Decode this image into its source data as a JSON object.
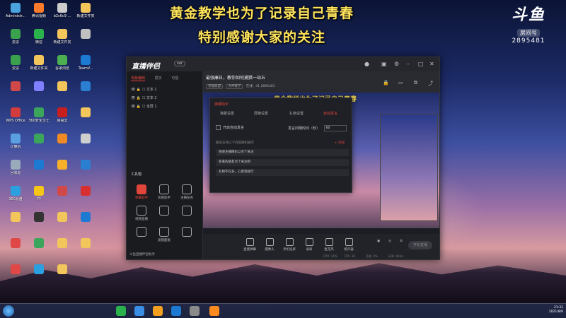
{
  "banner": {
    "line1": "黄金教学也为了记录自己青春",
    "line2": "特别感谢大家的关注"
  },
  "douyu": {
    "logo": "斗鱼",
    "room_label": "房间号",
    "room_number": "2895481"
  },
  "desktop_icons": [
    {
      "label": "Administr...",
      "color": "#4aa3df"
    },
    {
      "label": "腾讯视频",
      "color": "#ff7a2a"
    },
    {
      "label": "b2c6c9 ...",
      "color": "#cccccc"
    },
    {
      "label": "新建文件夹",
      "color": "#f3c65c"
    },
    {
      "label": "爱思",
      "color": "#3aa14d"
    },
    {
      "label": "微信",
      "color": "#2bb24c"
    },
    {
      "label": "新建文件夹",
      "color": "#f3c65c"
    },
    {
      "label": "",
      "color": "#c0c0c0"
    },
    {
      "label": "爱思",
      "color": "#3aa14d"
    },
    {
      "label": "新建文件夹",
      "color": "#f3c65c"
    },
    {
      "label": "谷歌浏览",
      "color": "#4caf50"
    },
    {
      "label": "TeamV...",
      "color": "#1c7ad3"
    },
    {
      "label": "",
      "color": "#d04848"
    },
    {
      "label": "",
      "color": "#7f7fff"
    },
    {
      "label": "",
      "color": "#f3c65c"
    },
    {
      "label": "",
      "color": "#2a7fd1"
    },
    {
      "label": "WPS Office",
      "color": "#d23c3c"
    },
    {
      "label": "360安全卫士",
      "color": "#3ba55c"
    },
    {
      "label": "网易云",
      "color": "#c81e1e"
    },
    {
      "label": "",
      "color": "#f3c65c"
    },
    {
      "label": "计算机",
      "color": "#5aa0e0"
    },
    {
      "label": "",
      "color": "#3ba55c"
    },
    {
      "label": "",
      "color": "#f08a24"
    },
    {
      "label": "",
      "color": "#cfcfcf"
    },
    {
      "label": "回收站",
      "color": "#9ab"
    },
    {
      "label": "",
      "color": "#1c7ad3"
    },
    {
      "label": "",
      "color": "#f6b12b"
    },
    {
      "label": "",
      "color": "#2a7fd1"
    },
    {
      "label": "360云盘",
      "color": "#2aa0e0"
    },
    {
      "label": "YY",
      "color": "#f5c518"
    },
    {
      "label": "",
      "color": "#d04848"
    },
    {
      "label": "",
      "color": "#d83030"
    },
    {
      "label": "",
      "color": "#f3c65c"
    },
    {
      "label": "",
      "color": "#333333"
    },
    {
      "label": "",
      "color": "#f3c65c"
    },
    {
      "label": "",
      "color": "#1c7ad3"
    },
    {
      "label": "",
      "color": "#e04848"
    },
    {
      "label": "",
      "color": "#3ba55c"
    },
    {
      "label": "",
      "color": "#f3c65c"
    },
    {
      "label": "",
      "color": "#f3c65c"
    },
    {
      "label": "",
      "color": "#e04848"
    },
    {
      "label": "",
      "color": "#2aa0e0"
    },
    {
      "label": "",
      "color": "#f3c65c"
    }
  ],
  "app": {
    "name": "直播伴侣",
    "version": "ver",
    "left_tabs": [
      "场景编辑",
      "层次",
      "可视"
    ],
    "scenes": [
      "文本 1",
      "文本 2",
      "全屏 1"
    ],
    "tools_title": "工具箱",
    "tools": [
      {
        "label": "弹幕助手",
        "highlight": true
      },
      {
        "label": "房管助手",
        "highlight": false
      },
      {
        "label": "主播任务",
        "highlight": false
      },
      {
        "label": "视频直播",
        "highlight": false
      },
      {
        "label": "",
        "highlight": false
      },
      {
        "label": "",
        "highlight": false
      },
      {
        "label": "",
        "highlight": false
      },
      {
        "label": "滤镜面板",
        "highlight": false
      },
      {
        "label": "",
        "highlight": false
      }
    ],
    "footer": "斗鱼直播伴侣助手",
    "room_title": "最强康日，教你如何捕猎一站五",
    "room_tag": "修改",
    "room_meta": [
      "英雄联盟",
      "大神教学"
    ],
    "room_stats": "在线：41  2895481",
    "preview_subtitle": "黄金教学也为了记录自己青春",
    "dialog": {
      "title": "弹幕助手",
      "tabs": [
        "弹幕设置",
        "屏蔽设置",
        "礼物设置",
        "自动发言"
      ],
      "active_tab_index": 3,
      "checkbox_label": "开启自动发言",
      "freq_label": "发言间隔时间（秒）",
      "freq_value": "60",
      "hint": "最多支持以下内容随机展示",
      "add_label": "+ 添加",
      "messages": [
        "感谢主播精彩以点个关注",
        "新来的朋友点个关注吧",
        "礼物不在多，心意到就行"
      ]
    },
    "bottom_tools": [
      "直播弹幕",
      "摄像头",
      "手机投屏",
      "录屏",
      "麦克风",
      "扬声器"
    ],
    "go_live": "开始直播",
    "status_items": [
      "CPU: 14%",
      "FPS: 30",
      "丢帧: 0%",
      "码率: 0kb/s"
    ]
  },
  "taskbar": {
    "time": "21:31",
    "date": "2021/8/8"
  }
}
